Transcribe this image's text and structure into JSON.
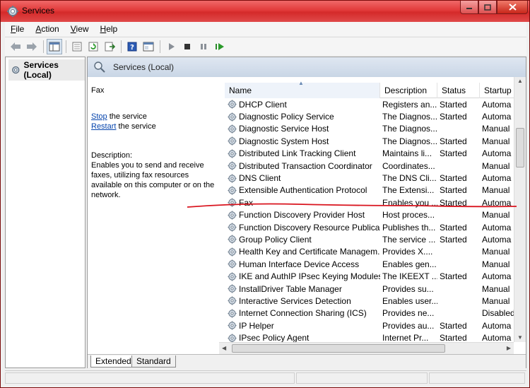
{
  "window": {
    "title": "Services"
  },
  "menu": [
    "File",
    "Action",
    "View",
    "Help"
  ],
  "tree": {
    "root": "Services (Local)"
  },
  "pane": {
    "header": "Services (Local)"
  },
  "details": {
    "service_name": "Fax",
    "stop_link": "Stop",
    "stop_rest": " the service",
    "restart_link": "Restart",
    "restart_rest": " the service",
    "desc_label": "Description:",
    "desc_text": "Enables you to send and receive faxes, utilizing fax resources available on this computer or on the network."
  },
  "columns": {
    "name": "Name",
    "description": "Description",
    "status": "Status",
    "startup": "Startup"
  },
  "services": [
    {
      "name": "DHCP Client",
      "description": "Registers an...",
      "status": "Started",
      "startup": "Automa"
    },
    {
      "name": "Diagnostic Policy Service",
      "description": "The Diagnos...",
      "status": "Started",
      "startup": "Automa"
    },
    {
      "name": "Diagnostic Service Host",
      "description": "The Diagnos...",
      "status": "",
      "startup": "Manual"
    },
    {
      "name": "Diagnostic System Host",
      "description": "The Diagnos...",
      "status": "Started",
      "startup": "Manual"
    },
    {
      "name": "Distributed Link Tracking Client",
      "description": "Maintains li...",
      "status": "Started",
      "startup": "Automa"
    },
    {
      "name": "Distributed Transaction Coordinator",
      "description": "Coordinates...",
      "status": "",
      "startup": "Manual"
    },
    {
      "name": "DNS Client",
      "description": "The DNS Cli...",
      "status": "Started",
      "startup": "Automa"
    },
    {
      "name": "Extensible Authentication Protocol",
      "description": "The Extensi...",
      "status": "Started",
      "startup": "Manual"
    },
    {
      "name": "Fax",
      "description": "Enables you ...",
      "status": "Started",
      "startup": "Automa"
    },
    {
      "name": "Function Discovery Provider Host",
      "description": "Host proces...",
      "status": "",
      "startup": "Manual"
    },
    {
      "name": "Function Discovery Resource Publica...",
      "description": "Publishes th...",
      "status": "Started",
      "startup": "Automa"
    },
    {
      "name": "Group Policy Client",
      "description": "The service ...",
      "status": "Started",
      "startup": "Automa"
    },
    {
      "name": "Health Key and Certificate Managem...",
      "description": "Provides X....",
      "status": "",
      "startup": "Manual"
    },
    {
      "name": "Human Interface Device Access",
      "description": "Enables gen...",
      "status": "",
      "startup": "Manual"
    },
    {
      "name": "IKE and AuthIP IPsec Keying Modules",
      "description": "The IKEEXT ...",
      "status": "Started",
      "startup": "Automa"
    },
    {
      "name": "InstallDriver Table Manager",
      "description": "Provides su...",
      "status": "",
      "startup": "Manual"
    },
    {
      "name": "Interactive Services Detection",
      "description": "Enables user...",
      "status": "",
      "startup": "Manual"
    },
    {
      "name": "Internet Connection Sharing (ICS)",
      "description": "Provides ne...",
      "status": "",
      "startup": "Disabled"
    },
    {
      "name": "IP Helper",
      "description": "Provides au...",
      "status": "Started",
      "startup": "Automa"
    },
    {
      "name": "IPsec Policy Agent",
      "description": "Internet Pr...",
      "status": "Started",
      "startup": "Automa"
    }
  ],
  "tabs": [
    "Extended",
    "Standard"
  ],
  "colors": {
    "annotation": "#d9141e",
    "titlebar": "#e23a3a",
    "link": "#0645ad"
  }
}
